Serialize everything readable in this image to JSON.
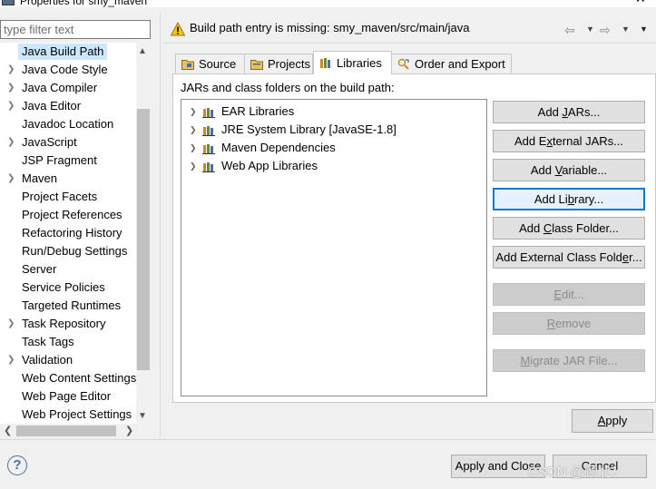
{
  "window": {
    "title": "Properties for smy_maven"
  },
  "filter": {
    "placeholder": "type filter text"
  },
  "nav": {
    "items": [
      {
        "label": "Java Build Path",
        "expandable": false,
        "selected": true
      },
      {
        "label": "Java Code Style",
        "expandable": true
      },
      {
        "label": "Java Compiler",
        "expandable": true
      },
      {
        "label": "Java Editor",
        "expandable": true
      },
      {
        "label": "Javadoc Location",
        "expandable": false
      },
      {
        "label": "JavaScript",
        "expandable": true
      },
      {
        "label": "JSP Fragment",
        "expandable": false
      },
      {
        "label": "Maven",
        "expandable": true
      },
      {
        "label": "Project Facets",
        "expandable": false
      },
      {
        "label": "Project References",
        "expandable": false
      },
      {
        "label": "Refactoring History",
        "expandable": false
      },
      {
        "label": "Run/Debug Settings",
        "expandable": false
      },
      {
        "label": "Server",
        "expandable": false
      },
      {
        "label": "Service Policies",
        "expandable": false
      },
      {
        "label": "Targeted Runtimes",
        "expandable": false
      },
      {
        "label": "Task Repository",
        "expandable": true
      },
      {
        "label": "Task Tags",
        "expandable": false
      },
      {
        "label": "Validation",
        "expandable": true
      },
      {
        "label": "Web Content Settings",
        "expandable": false
      },
      {
        "label": "Web Page Editor",
        "expandable": false
      },
      {
        "label": "Web Project Settings",
        "expandable": false
      }
    ]
  },
  "header": {
    "message": "Build path entry is missing: smy_maven/src/main/java"
  },
  "tabs": [
    {
      "label": "Source",
      "active": false
    },
    {
      "label": "Projects",
      "active": false
    },
    {
      "label": "Libraries",
      "active": true
    },
    {
      "label": "Order and Export",
      "active": false
    }
  ],
  "content": {
    "label": "JARs and class folders on the build path:",
    "tree": [
      {
        "label": "EAR Libraries"
      },
      {
        "label": "JRE System Library [JavaSE-1.8]"
      },
      {
        "label": "Maven Dependencies"
      },
      {
        "label": "Web App Libraries"
      }
    ]
  },
  "buttons": {
    "add_jars": {
      "pre": "Add ",
      "mn": "J",
      "post": "ARs..."
    },
    "add_external_jars": {
      "pre": "Add E",
      "mn": "x",
      "post": "ternal JARs..."
    },
    "add_variable": {
      "pre": "Add ",
      "mn": "V",
      "post": "ariable..."
    },
    "add_library": {
      "pre": "Add Li",
      "mn": "b",
      "post": "rary..."
    },
    "add_class_folder": {
      "pre": "Add ",
      "mn": "C",
      "post": "lass Folder..."
    },
    "add_external_class_folder": {
      "pre": "Add External Class Fold",
      "mn": "e",
      "post": "r..."
    },
    "edit": {
      "pre": "",
      "mn": "E",
      "post": "dit..."
    },
    "remove": {
      "pre": "",
      "mn": "R",
      "post": "emove"
    },
    "migrate": {
      "pre": "",
      "mn": "M",
      "post": "igrate JAR File..."
    },
    "apply": {
      "pre": "",
      "mn": "A",
      "post": "pply"
    },
    "apply_close": "Apply and Close",
    "cancel": "Cancel"
  },
  "watermark": "CSDN @顾北！",
  "colors": {
    "selection": "#cce8ff",
    "focus_border": "#0078d7",
    "disabled_bg": "#cccccc",
    "disabled_text": "#8a8a8a"
  }
}
